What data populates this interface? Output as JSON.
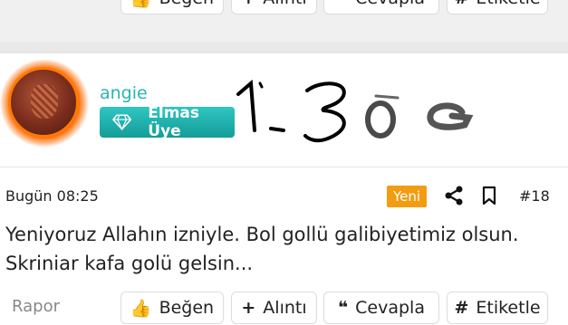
{
  "top_actions": [
    {
      "label": "Beğen",
      "icon": "like-icon"
    },
    {
      "label": "Alıntı",
      "icon": "plus-icon"
    },
    {
      "label": "Cevapla",
      "icon": "quote-icon"
    },
    {
      "label": "Etiketle",
      "icon": "hashtag-icon"
    }
  ],
  "user": {
    "name": "angie",
    "badge": "Elmas Üye",
    "badge_icon": "diamond-icon",
    "handwriting": "1.30G",
    "colors": {
      "name": "#2bb5b0",
      "badge": "#1aa8a4",
      "avatar_ring": "#ff7a00"
    }
  },
  "post": {
    "date": "Bugün 08:25",
    "new_label": "Yeni",
    "number": "#18",
    "message": "Yeniyoruz Allahın izniyle. Bol gollü galibiyetimiz olsun. Skriniar kafa golü gelsin...",
    "report": "Rapor"
  },
  "bottom_actions": [
    {
      "label": "Beğen",
      "icon": "like-icon"
    },
    {
      "label": "Alıntı",
      "icon": "plus-icon"
    },
    {
      "label": "Cevapla",
      "icon": "quote-icon"
    },
    {
      "label": "Etiketle",
      "icon": "hashtag-icon"
    }
  ]
}
